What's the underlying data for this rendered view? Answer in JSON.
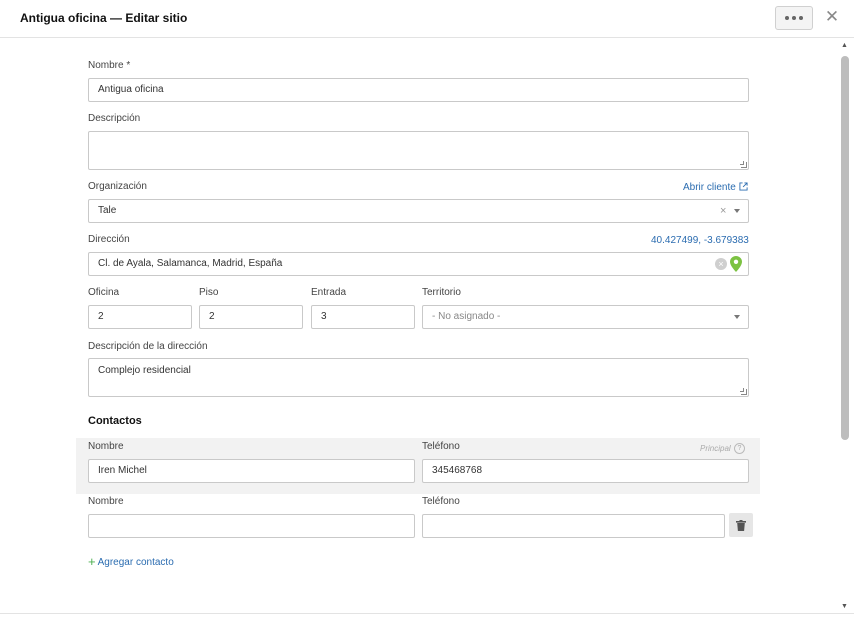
{
  "dialog": {
    "title": "Antigua oficina — Editar sitio",
    "more_label": "•••",
    "close_label": "✕"
  },
  "form": {
    "name_label": "Nombre *",
    "name_value": "Antigua oficina",
    "description_label": "Descripción",
    "description_value": "",
    "organization_label": "Organización",
    "open_client_link": "Abrir cliente",
    "organization_value": "Tale",
    "address_label": "Dirección",
    "coordinates": "40.427499, -3.679383",
    "address_value": "Cl. de Ayala, Salamanca, Madrid, España",
    "office_label": "Oficina",
    "office_value": "2",
    "floor_label": "Piso",
    "floor_value": "2",
    "entrance_label": "Entrada",
    "entrance_value": "3",
    "territory_label": "Territorio",
    "territory_value": "- No asignado -",
    "address_desc_label": "Descripción de la dirección",
    "address_desc_value": "Complejo residencial"
  },
  "contacts": {
    "section_title": "Contactos",
    "principal_label": "Principal",
    "rows": [
      {
        "name_label": "Nombre",
        "phone_label": "Teléfono",
        "name_value": "Iren Michel",
        "phone_value": "345468768"
      },
      {
        "name_label": "Nombre",
        "phone_label": "Teléfono",
        "name_value": "",
        "phone_value": ""
      }
    ],
    "add_label": "Agregar contacto"
  },
  "icons": {
    "map_pin_color": "#7cc242",
    "link_color": "#2b6cb0"
  }
}
